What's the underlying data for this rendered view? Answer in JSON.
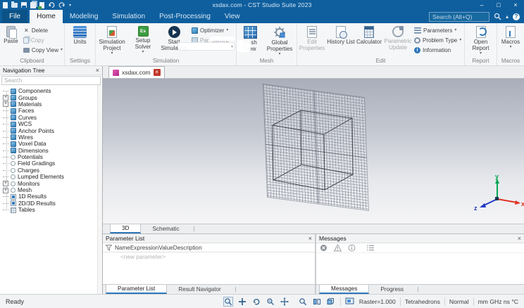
{
  "window": {
    "title": "xsdax.com - CST Studio Suite 2023"
  },
  "titlebar": {
    "search_placeholder": "Search (Alt+Q)"
  },
  "icons": {
    "help": "?",
    "solver_badge": "Es",
    "info_badge": "i",
    "caret_down": "▾",
    "caret_up": "▴",
    "close": "×",
    "minimize": "–",
    "maximize": "□"
  },
  "menu_tabs": [
    {
      "label": "File",
      "state": "file"
    },
    {
      "label": "Home",
      "state": "selected"
    },
    {
      "label": "Modeling",
      "state": ""
    },
    {
      "label": "Simulation",
      "state": ""
    },
    {
      "label": "Post-Processing",
      "state": ""
    },
    {
      "label": "View",
      "state": ""
    }
  ],
  "ribbon": {
    "clipboard": {
      "label": "Clipboard",
      "paste": "Paste",
      "delete": "Delete",
      "copy": "Copy",
      "copy_view": "Copy View"
    },
    "settings": {
      "label": "Settings",
      "units": "Units"
    },
    "simulation": {
      "label": "Simulation",
      "simulation_project": "Simulation Project",
      "setup_solver": "Setup Solver",
      "start_simulation": "Start Simulation",
      "optimizer": "Optimizer",
      "par_sweep": "Par. Sweep"
    },
    "mesh": {
      "label": "Mesh",
      "mesh_view": "Mesh View",
      "global_properties": "Global Properties"
    },
    "edit": {
      "label": "Edit",
      "edit_properties": "Edit Properties",
      "history_list": "History List",
      "calculator": "Calculator",
      "parametric_update": "Parametric Update",
      "parameters": "Parameters",
      "problem_type": "Problem Type",
      "information": "Information"
    },
    "report": {
      "label": "Report",
      "open_report": "Open Report"
    },
    "macros": {
      "label": "Macros",
      "macros": "Macros"
    }
  },
  "nav_tree": {
    "title": "Navigation Tree",
    "search_placeholder": "Search",
    "items": [
      {
        "label": "Components",
        "icon": "cube",
        "expand": "none"
      },
      {
        "label": "Groups",
        "icon": "cube",
        "expand": "plus"
      },
      {
        "label": "Materials",
        "icon": "cube",
        "expand": "plus"
      },
      {
        "label": "Faces",
        "icon": "cube",
        "expand": "none"
      },
      {
        "label": "Curves",
        "icon": "cube",
        "expand": "none"
      },
      {
        "label": "WCS",
        "icon": "cube",
        "expand": "none"
      },
      {
        "label": "Anchor Points",
        "icon": "cube",
        "expand": "none"
      },
      {
        "label": "Wires",
        "icon": "cube",
        "expand": "none"
      },
      {
        "label": "Voxel Data",
        "icon": "cube",
        "expand": "none"
      },
      {
        "label": "Dimensions",
        "icon": "cube",
        "expand": "none"
      },
      {
        "label": "Potentials",
        "icon": "ring",
        "expand": "none"
      },
      {
        "label": "Field Gradings",
        "icon": "ring",
        "expand": "none"
      },
      {
        "label": "Charges",
        "icon": "ring",
        "expand": "none"
      },
      {
        "label": "Lumped Elements",
        "icon": "ring",
        "expand": "none"
      },
      {
        "label": "Monitors",
        "icon": "ring",
        "expand": "plus"
      },
      {
        "label": "Mesh",
        "icon": "ring",
        "expand": "plus"
      },
      {
        "label": "1D Results",
        "icon": "chart",
        "expand": "none"
      },
      {
        "label": "2D/3D Results",
        "icon": "chart",
        "expand": "none"
      },
      {
        "label": "Tables",
        "icon": "table",
        "expand": "none"
      }
    ]
  },
  "document_tab": {
    "label": "xsdax.com"
  },
  "viewport_tabs": {
    "d3": "3D",
    "schematic": "Schematic"
  },
  "axes": {
    "x": "x",
    "y": "y",
    "z": "z"
  },
  "parameter_list": {
    "title": "Parameter List",
    "columns": [
      {
        "label": "Name"
      },
      {
        "label": "Expression"
      },
      {
        "label": "Value"
      },
      {
        "label": "Description"
      }
    ],
    "new_row": "<new parameter>",
    "tabs": {
      "parameter_list": "Parameter List",
      "result_navigator": "Result Navigator"
    }
  },
  "messages": {
    "title": "Messages",
    "tabs": {
      "messages": "Messages",
      "progress": "Progress"
    }
  },
  "status_bar": {
    "ready": "Ready",
    "raster": "Raster=1.000",
    "mesh_cells": "Tetrahedrons",
    "view_mode": "Normal",
    "units": "mm GHz ns °C"
  }
}
